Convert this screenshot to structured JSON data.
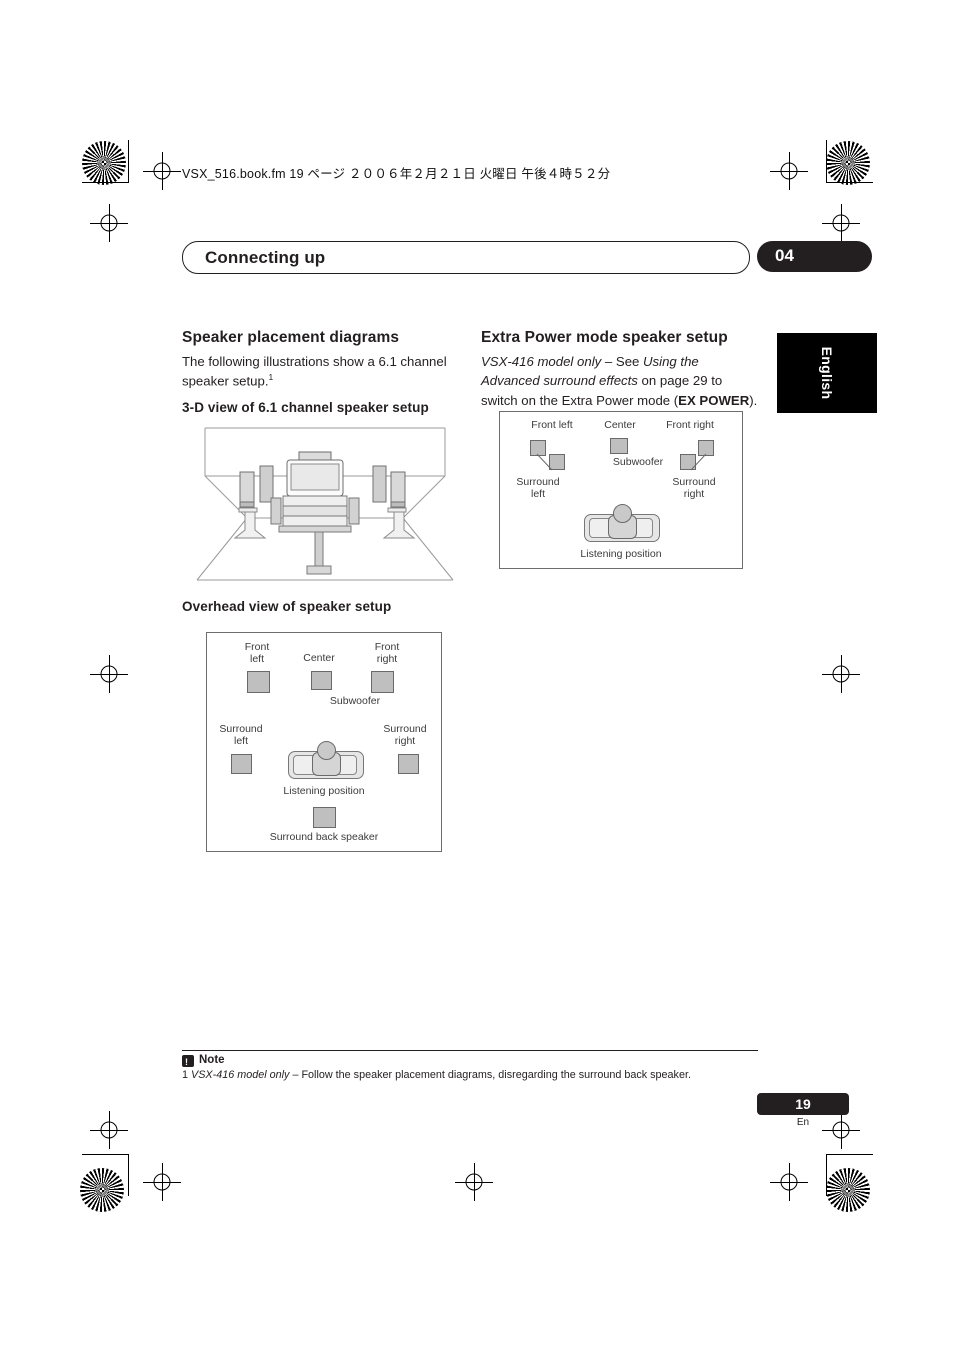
{
  "header": {
    "file_line": "VSX_516.book.fm  19 ページ  ２００６年２月２１日   火曜日   午後４時５２分"
  },
  "titlebar": {
    "title": "Connecting up",
    "chapter": "04"
  },
  "side_tab": {
    "language": "English"
  },
  "left_column": {
    "heading": "Speaker placement diagrams",
    "intro": "The following illustrations show a 6.1 channel speaker setup.",
    "intro_footnote": "1",
    "subheading_3d": "3-D view of 6.1 channel speaker setup",
    "subheading_overhead": "Overhead view of speaker setup"
  },
  "right_column": {
    "heading": "Extra Power mode speaker setup",
    "text_1_italic": "VSX-416 model only",
    "text_2": " – See ",
    "text_3_italic": "Using the Advanced surround effects",
    "text_4": " on page 29 to switch on the Extra Power mode (",
    "text_5_bold": "EX POWER",
    "text_6": ")."
  },
  "overhead_diagram": {
    "labels": {
      "front_left": "Front\nleft",
      "center": "Center",
      "front_right": "Front\nright",
      "subwoofer": "Subwoofer",
      "surround_left": "Surround\nleft",
      "surround_right": "Surround\nright",
      "listening_position": "Listening position",
      "surround_back": "Surround back speaker"
    }
  },
  "expower_diagram": {
    "labels": {
      "front_left": "Front left",
      "center": "Center",
      "front_right": "Front right",
      "subwoofer": "Subwoofer",
      "surround_left": "Surround\nleft",
      "surround_right": "Surround\nright",
      "listening_position": "Listening position"
    }
  },
  "note": {
    "badge": "!",
    "label": "Note",
    "marker": "1",
    "italic_part": "VSX-416 model only",
    "rest": " – Follow the speaker placement diagrams, disregarding the surround back speaker."
  },
  "footer": {
    "page_number": "19",
    "language_code": "En"
  }
}
